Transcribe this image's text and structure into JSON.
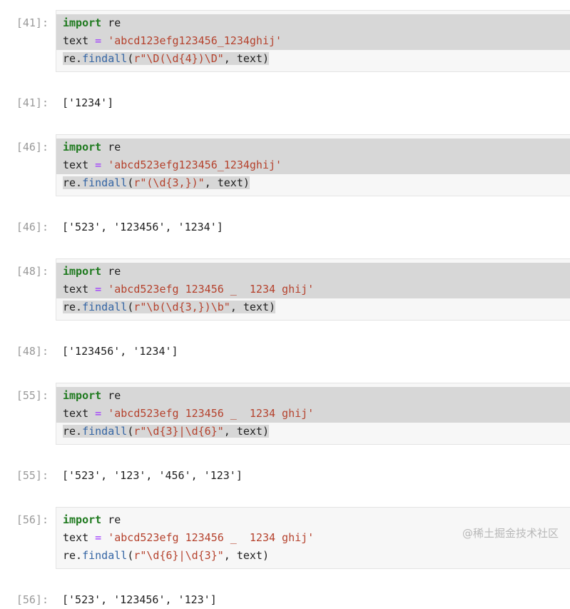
{
  "notebook": {
    "cells": [
      {
        "prompt_in": "[41]:",
        "prompt_out": "[41]:",
        "lines": [
          {
            "kw": "import",
            "rest": " re",
            "highlight": "full"
          },
          {
            "name": "text",
            "op": " = ",
            "str": "'abcd123efg123456_1234ghij'",
            "highlight": "full"
          },
          {
            "pre": "re.",
            "fn": "findall",
            "open": "(",
            "str": "r\"\\D(\\d{4})\\D\"",
            "tail": ", text)",
            "highlight": "partial"
          }
        ],
        "output": "['1234']"
      },
      {
        "prompt_in": "[46]:",
        "prompt_out": "[46]:",
        "lines": [
          {
            "kw": "import",
            "rest": " re",
            "highlight": "full"
          },
          {
            "name": "text",
            "op": " = ",
            "str": "'abcd523efg123456_1234ghij'",
            "highlight": "full"
          },
          {
            "pre": "re.",
            "fn": "findall",
            "open": "(",
            "str": "r\"(\\d{3,})\"",
            "tail": ", text)",
            "highlight": "partial"
          }
        ],
        "output": "['523', '123456', '1234']"
      },
      {
        "prompt_in": "[48]:",
        "prompt_out": "[48]:",
        "lines": [
          {
            "kw": "import",
            "rest": " re",
            "highlight": "full"
          },
          {
            "name": "text",
            "op": " = ",
            "str": "'abcd523efg 123456 _  1234 ghij'",
            "highlight": "full"
          },
          {
            "pre": "re.",
            "fn": "findall",
            "open": "(",
            "str": "r\"\\b(\\d{3,})\\b\"",
            "tail": ", text)",
            "highlight": "partial"
          }
        ],
        "output": "['123456', '1234']"
      },
      {
        "prompt_in": "[55]:",
        "prompt_out": "[55]:",
        "lines": [
          {
            "kw": "import",
            "rest": " re",
            "highlight": "full"
          },
          {
            "name": "text",
            "op": " = ",
            "str": "'abcd523efg 123456 _  1234 ghij'",
            "highlight": "full"
          },
          {
            "pre": "re.",
            "fn": "findall",
            "open": "(",
            "str": "r\"\\d{3}|\\d{6}\"",
            "tail": ", text)",
            "highlight": "partial"
          }
        ],
        "output": "['523', '123', '456', '123']"
      },
      {
        "prompt_in": "[56]:",
        "prompt_out": "[56]:",
        "lines": [
          {
            "kw": "import",
            "rest": " re",
            "highlight": "none"
          },
          {
            "name": "text",
            "op": " = ",
            "str": "'abcd523efg 123456 _  1234 ghij'",
            "highlight": "none"
          },
          {
            "pre": "re.",
            "fn": "findall",
            "open": "(",
            "str": "r\"\\d{6}|\\d{3}\"",
            "tail": ", text)",
            "highlight": "none"
          }
        ],
        "output": "['523', '123456', '123']"
      }
    ],
    "watermark": "@稀土掘金技术社区",
    "colors": {
      "cell_background": "#f7f7f7",
      "selection_highlight": "#d7d7d7",
      "keyword": "#1f7a1f",
      "string": "#b5422d",
      "function": "#3465a4",
      "operator": "#9b30ff",
      "prompt": "#999999",
      "text": "#212121",
      "watermark": "#b8b8b8"
    }
  }
}
